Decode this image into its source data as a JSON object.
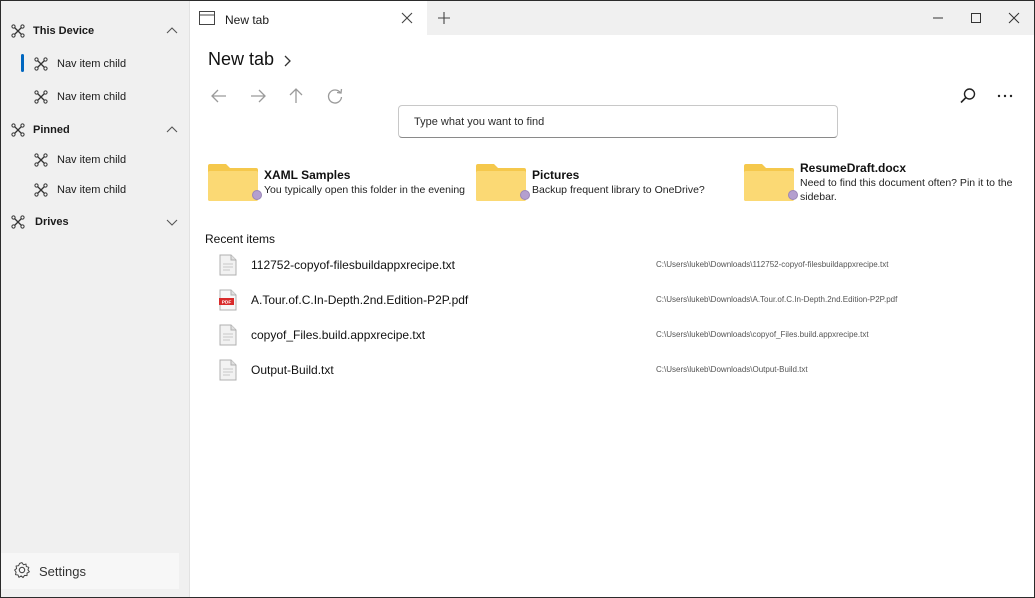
{
  "sidebar": {
    "groups": [
      {
        "label": "This Device",
        "children": [
          "Nav item child",
          "Nav item child"
        ]
      },
      {
        "label": "Pinned",
        "children": [
          "Nav item child",
          "Nav item child"
        ]
      },
      {
        "label": "Drives",
        "children": []
      }
    ],
    "settings_label": "Settings"
  },
  "tab": {
    "title": "New tab"
  },
  "page": {
    "title": "New tab"
  },
  "search": {
    "placeholder": "Type what you want to find"
  },
  "quick_access": [
    {
      "title": "XAML Samples",
      "subtitle": "You typically open this folder in the evening",
      "icon": "folder-icon"
    },
    {
      "title": "Pictures",
      "subtitle": "Backup frequent library to OneDrive?",
      "icon": "folder-icon"
    },
    {
      "title": "ResumeDraft.docx",
      "subtitle": "Need to find this document often? Pin it to the sidebar.",
      "icon": "folder-icon"
    }
  ],
  "recent": {
    "title": "Recent items",
    "items": [
      {
        "name": "112752-copyof-filesbuildappxrecipe.txt",
        "path": "C:\\Users\\lukeb\\Downloads\\112752-copyof-filesbuildappxrecipe.txt",
        "icon": "text-file-icon"
      },
      {
        "name": "A.Tour.of.C.In-Depth.2nd.Edition-P2P.pdf",
        "path": "C:\\Users\\lukeb\\Downloads\\A.Tour.of.C.In-Depth.2nd.Edition-P2P.pdf",
        "icon": "pdf-file-icon"
      },
      {
        "name": "copyof_Files.build.appxrecipe.txt",
        "path": "C:\\Users\\lukeb\\Downloads\\copyof_Files.build.appxrecipe.txt",
        "icon": "text-file-icon"
      },
      {
        "name": "Output-Build.txt",
        "path": "C:\\Users\\lukeb\\Downloads\\Output-Build.txt",
        "icon": "text-file-icon"
      }
    ]
  },
  "pdf_badge": "PDF",
  "colors": {
    "accent": "#0067c0",
    "folder": "#fbd974",
    "folder_tab": "#f5c84c",
    "sidebar_bg": "#f0f0f0"
  }
}
